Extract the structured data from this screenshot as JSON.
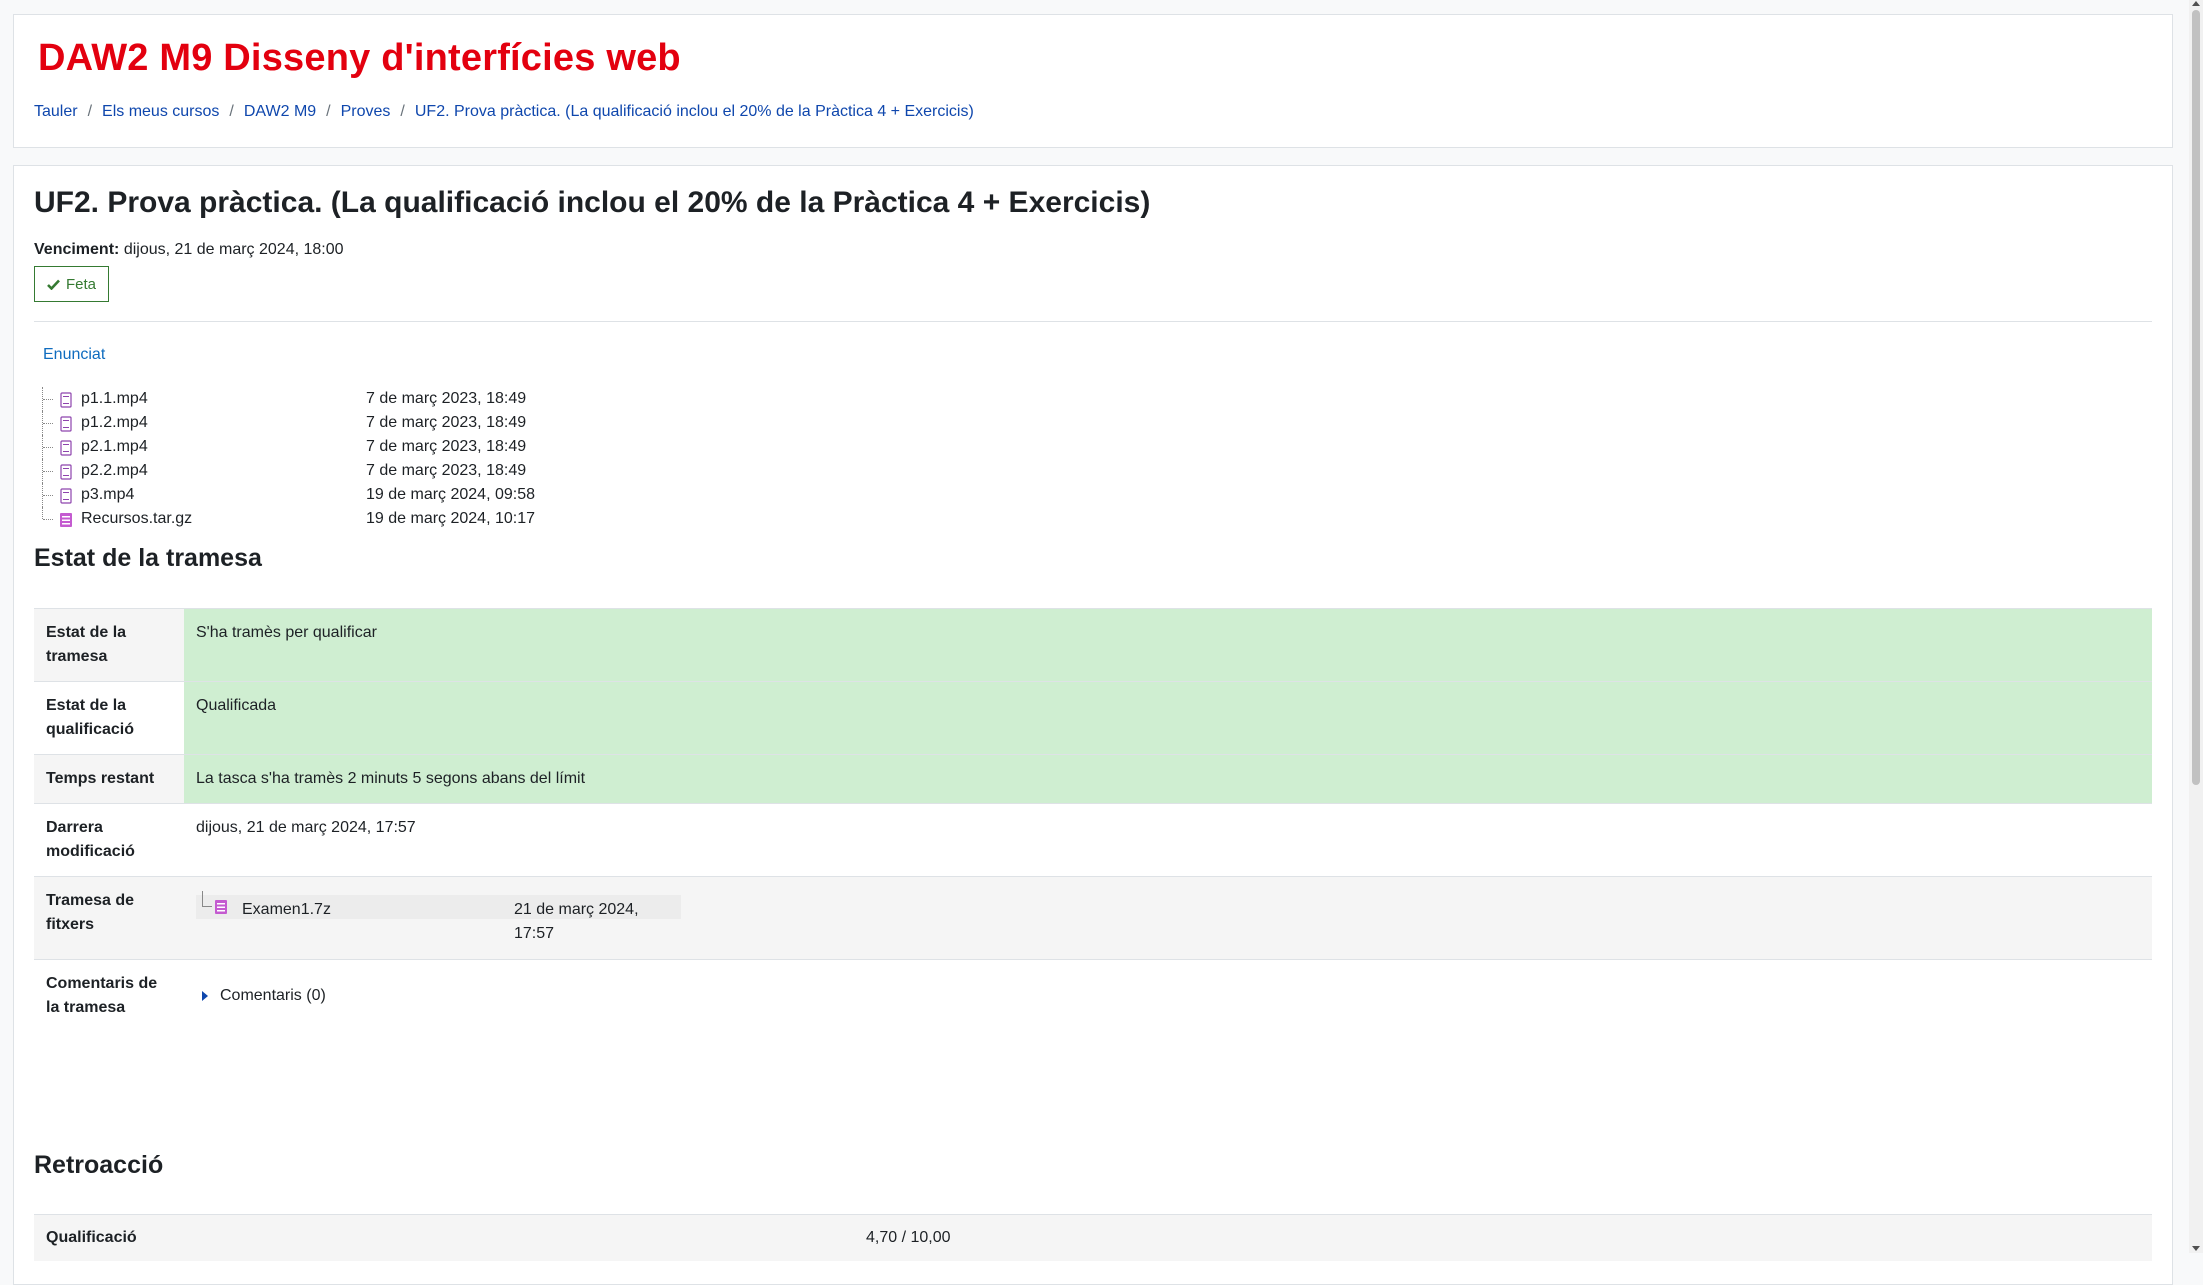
{
  "course": {
    "title": "DAW2 M9 Disseny d'interfícies web"
  },
  "breadcrumb": [
    "Tauler",
    "Els meus cursos",
    "DAW2 M9",
    "Proves",
    "UF2. Prova pràctica. (La qualificació inclou el 20% de la Pràctica 4 + Exercicis)"
  ],
  "assignment": {
    "title": "UF2. Prova pràctica. (La qualificació inclou el 20% de la Pràctica 4 + Exercicis)",
    "due_label": "Venciment:",
    "due_value": "dijous, 21 de març 2024, 18:00",
    "done_label": "Feta",
    "intro_folder": "Enunciat",
    "files": [
      {
        "name": "p1.1.mp4",
        "date": "7 de març 2023, 18:49",
        "icon": "video-file-icon"
      },
      {
        "name": "p1.2.mp4",
        "date": "7 de març 2023, 18:49",
        "icon": "video-file-icon"
      },
      {
        "name": "p2.1.mp4",
        "date": "7 de març 2023, 18:49",
        "icon": "video-file-icon"
      },
      {
        "name": "p2.2.mp4",
        "date": "7 de març 2023, 18:49",
        "icon": "video-file-icon"
      },
      {
        "name": "p3.mp4",
        "date": "19 de març 2024, 09:58",
        "icon": "video-file-icon"
      },
      {
        "name": "Recursos.tar.gz",
        "date": "19 de març 2024, 10:17",
        "icon": "archive-file-icon"
      }
    ]
  },
  "submission_status": {
    "heading": "Estat de la tramesa",
    "rows": [
      {
        "label": "Estat de la tramesa",
        "value": "S'ha tramès per qualificar"
      },
      {
        "label": "Estat de la qualificació",
        "value": "Qualificada"
      },
      {
        "label": "Temps restant",
        "value": "La tasca s'ha tramès 2 minuts 5 segons abans del límit"
      },
      {
        "label": "Darrera modificació",
        "value": "dijous, 21 de març 2024, 17:57"
      },
      {
        "label": "Tramesa de fitxers",
        "file_name": "Examen1.7z",
        "file_date": "21 de març 2024, 17:57"
      },
      {
        "label": "Comentaris de la tramesa",
        "value": "Comentaris (0)"
      }
    ]
  },
  "feedback": {
    "heading": "Retroacció",
    "grade_label": "Qualificació",
    "grade_value": "4,70 / 10,00"
  },
  "colors": {
    "course_title": "#e3000f",
    "link": "#0f47ad",
    "success_bg": "#cfeed1",
    "done_badge": "#357a32"
  }
}
